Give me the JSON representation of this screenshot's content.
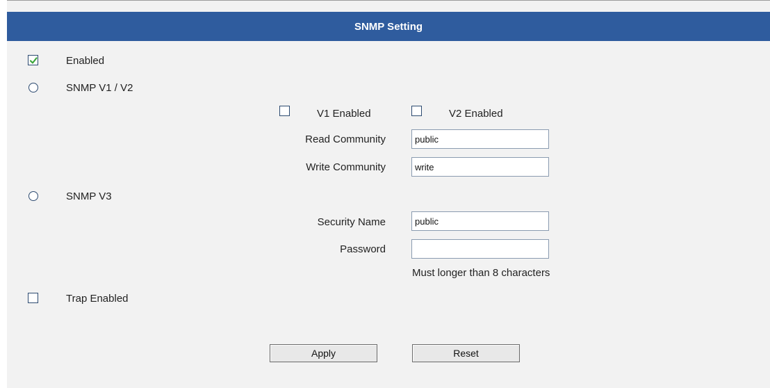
{
  "header": {
    "title": "SNMP Setting"
  },
  "enabled": {
    "label": "Enabled",
    "checked": true
  },
  "snmp_v1v2": {
    "label": "SNMP V1 / V2",
    "selected": false,
    "v1_enabled": {
      "label": "V1 Enabled",
      "checked": false
    },
    "v2_enabled": {
      "label": "V2 Enabled",
      "checked": false
    },
    "read_community": {
      "label": "Read Community",
      "value": "public"
    },
    "write_community": {
      "label": "Write Community",
      "value": "write"
    }
  },
  "snmp_v3": {
    "label": "SNMP V3",
    "selected": false,
    "security_name": {
      "label": "Security Name",
      "value": "public"
    },
    "password": {
      "label": "Password",
      "value": "",
      "hint": "Must longer than 8 characters"
    }
  },
  "trap": {
    "label": "Trap Enabled",
    "checked": false
  },
  "buttons": {
    "apply": "Apply",
    "reset": "Reset"
  },
  "colors": {
    "header_bg": "#2f5c9e",
    "check_mark": "#3aa53a"
  }
}
